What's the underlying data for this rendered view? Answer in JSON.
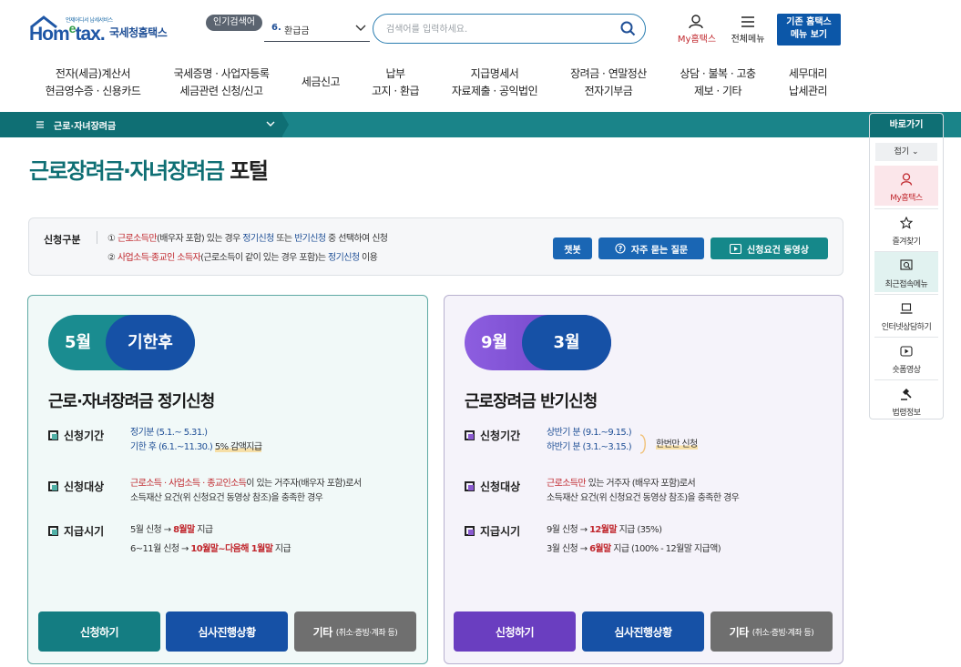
{
  "header": {
    "logo": {
      "tagline": "언제어디서 납세서비스",
      "en_prefix": "Hom",
      "en_small": "e",
      "en_suffix": "tax.",
      "kr": "국세청홈택스"
    },
    "popular_label": "인기검색어",
    "popular_rank": "6.",
    "popular_term": "환급금",
    "search_placeholder": "검색어를 입력하세요.",
    "my_hometax": "My홈택스",
    "all_menu": "전체메뉴",
    "old_hometax_line1": "기존 홈택스",
    "old_hometax_line2": "메뉴 보기"
  },
  "gnb": [
    {
      "l1": "전자(세금)계산서",
      "l2": "현금영수증 · 신용카드"
    },
    {
      "l1": "국세증명 · 사업자등록",
      "l2": "세금관련 신청/신고"
    },
    {
      "l1": "세금신고",
      "l2": ""
    },
    {
      "l1": "납부",
      "l2": "고지 · 환급"
    },
    {
      "l1": "지급명세서",
      "l2": "자료제출 · 공익법인"
    },
    {
      "l1": "장려금 · 연말정산",
      "l2": "전자기부금"
    },
    {
      "l1": "상담 · 불복 · 고충",
      "l2": "제보 · 기타"
    },
    {
      "l1": "세무대리",
      "l2": "납세관리"
    }
  ],
  "breadcrumb": {
    "label": "근로·자녀장려금"
  },
  "quick": {
    "title": "바로가기",
    "fold": "접기",
    "items": [
      "My홈택스",
      "즐겨찾기",
      "최근접속메뉴",
      "인터넷상담하기",
      "숏폼영상",
      "법령정보"
    ]
  },
  "page": {
    "title_main": "근로장려금·자녀장려금",
    "title_suffix": " 포털"
  },
  "info": {
    "label": "신청구분",
    "line1": {
      "num": "① ",
      "red": "근로소득만",
      "t1": "(배우자 포함) 있는 경우 ",
      "b1": "정기신청",
      "t2": " 또는 ",
      "b2": "반기신청",
      "t3": " 중 선택하여 신청"
    },
    "line2": {
      "num": "② ",
      "red": "사업소득·종교인 소득자",
      "t1": "(근로소득이 같이 있는 경우 포함)는 ",
      "b1": "정기신청",
      "t2": " 이용"
    },
    "buttons": {
      "chatbot": "챗봇",
      "faq": "자주 묻는 질문",
      "video": "신청요건 동영상"
    }
  },
  "card_regular": {
    "pill_left": "5월",
    "pill_right": "기한후",
    "title": "근로·자녀장려금 정기신청",
    "period_label": "신청기간",
    "period_1": "정기분 (5.1.~ 5.31.)",
    "period_2_a": "기한 후 (6.1.~11.30.)",
    "period_2_b": "5% 감액지급",
    "target_label": "신청대상",
    "target_red": "근로소득 · 사업소득 · 종교인소득",
    "target_t1": "이 있는 거주자(배우자 포함)로서",
    "target_t2": "소득재산 요건(위 신청요건 동영상 참조)을 충족한 경우",
    "pay_label": "지급시기",
    "pay_1a": "5월 신청 → ",
    "pay_1b": "8월말",
    "pay_1c": " 지급",
    "pay_2a": "6~11월 신청 → ",
    "pay_2b": "10월말~다음해 1월말",
    "pay_2c": " 지급",
    "btn_apply": "신청하기",
    "btn_status": "심사진행상황",
    "btn_etc": "기타",
    "btn_etc_small": "(취소·증빙·계좌 등)"
  },
  "card_half": {
    "pill_left": "9월",
    "pill_right": "3월",
    "title": "근로장려금 반기신청",
    "period_label": "신청기간",
    "period_1": "상반기 분 (9.1.~9.15.)",
    "period_2": "하반기 분 (3.1.~3.15.)",
    "period_note": "한번만 신청",
    "target_label": "신청대상",
    "target_red": "근로소득만",
    "target_t1": " 있는 거주자 (배우자 포함)로서",
    "target_t2": "소득재산 요건(위 신청요건 동영상 참조)을 충족한 경우",
    "pay_label": "지급시기",
    "pay_1a": "9월 신청 → ",
    "pay_1b": "12월말",
    "pay_1c": " 지급 (35%)",
    "pay_2a": "3월 신청 → ",
    "pay_2b": "6월말",
    "pay_2c": " 지급 (100% - 12월말 지급액)",
    "btn_apply": "신청하기",
    "btn_status": "심사진행상황",
    "btn_etc": "기타",
    "btn_etc_small": "(취소·증빙·계좌 등)"
  },
  "colors": {
    "teal": "#0f6f74",
    "blue": "#1651a6",
    "purple": "#6a3ec0",
    "gray": "#6f6f6f",
    "red": "#c0272d"
  }
}
